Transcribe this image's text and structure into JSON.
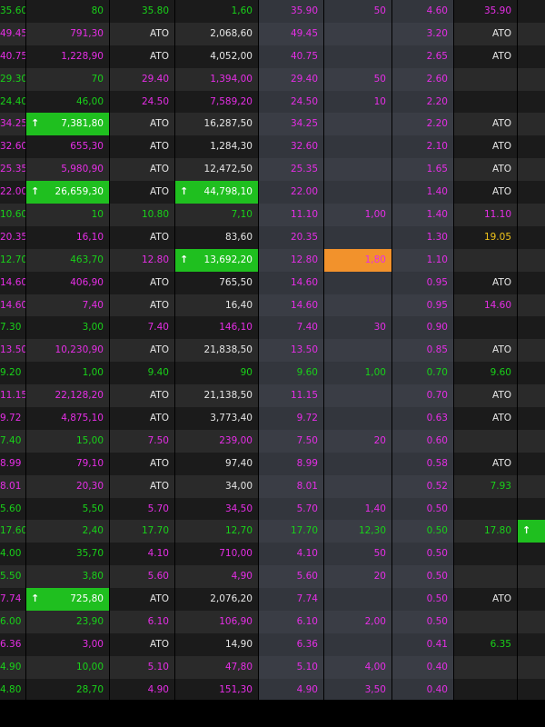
{
  "colors": {
    "green": "#19d219",
    "magenta": "#e62ee6",
    "white": "#e6e6e6",
    "yellow": "#f0c41b",
    "up_bg": "#1fbf1f",
    "highlight_bg": "#f2922c"
  },
  "rows": [
    [
      "35.60",
      "80",
      "35.80",
      "1,60",
      "35.90",
      "50",
      "4.60",
      "35.90"
    ],
    [
      "49.45",
      "791,30",
      "ATO",
      "2,068,60",
      "49.45",
      "",
      "3.20",
      "ATO"
    ],
    [
      "40.75",
      "1,228,90",
      "ATO",
      "4,052,00",
      "40.75",
      "",
      "2.65",
      "ATO"
    ],
    [
      "29.30",
      "70",
      "29.40",
      "1,394,00",
      "29.40",
      "50",
      "2.60",
      ""
    ],
    [
      "24.40",
      "46,00",
      "24.50",
      "7,589,20",
      "24.50",
      "10",
      "2.20",
      ""
    ],
    [
      "34.25",
      "7,381,80",
      "ATO",
      "16,287,50",
      "34.25",
      "",
      "2.20",
      "ATO"
    ],
    [
      "32.60",
      "655,30",
      "ATO",
      "1,284,30",
      "32.60",
      "",
      "2.10",
      "ATO"
    ],
    [
      "25.35",
      "5,980,90",
      "ATO",
      "12,472,50",
      "25.35",
      "",
      "1.65",
      "ATO"
    ],
    [
      "22.00",
      "26,659,30",
      "ATO",
      "44,798,10",
      "22.00",
      "",
      "1.40",
      "ATO"
    ],
    [
      "10.60",
      "10",
      "10.80",
      "7,10",
      "11.10",
      "1,00",
      "1.40",
      "11.10"
    ],
    [
      "20.35",
      "16,10",
      "ATO",
      "83,60",
      "20.35",
      "",
      "1.30",
      "19.05"
    ],
    [
      "12.70",
      "463,70",
      "12.80",
      "13,692,20",
      "12.80",
      "1,80",
      "1.10",
      ""
    ],
    [
      "14.60",
      "406,90",
      "ATO",
      "765,50",
      "14.60",
      "",
      "0.95",
      "ATO"
    ],
    [
      "14.60",
      "7,40",
      "ATO",
      "16,40",
      "14.60",
      "",
      "0.95",
      "14.60"
    ],
    [
      "7.30",
      "3,00",
      "7.40",
      "146,10",
      "7.40",
      "30",
      "0.90",
      ""
    ],
    [
      "13.50",
      "10,230,90",
      "ATO",
      "21,838,50",
      "13.50",
      "",
      "0.85",
      "ATO"
    ],
    [
      "9.20",
      "1,00",
      "9.40",
      "90",
      "9.60",
      "1,00",
      "0.70",
      "9.60"
    ],
    [
      "11.15",
      "22,128,20",
      "ATO",
      "21,138,50",
      "11.15",
      "",
      "0.70",
      "ATO"
    ],
    [
      "9.72",
      "4,875,10",
      "ATO",
      "3,773,40",
      "9.72",
      "",
      "0.63",
      "ATO"
    ],
    [
      "7.40",
      "15,00",
      "7.50",
      "239,00",
      "7.50",
      "20",
      "0.60",
      ""
    ],
    [
      "8.99",
      "79,10",
      "ATO",
      "97,40",
      "8.99",
      "",
      "0.58",
      "ATO"
    ],
    [
      "8.01",
      "20,30",
      "ATO",
      "34,00",
      "8.01",
      "",
      "0.52",
      "7.93"
    ],
    [
      "5.60",
      "5,50",
      "5.70",
      "34,50",
      "5.70",
      "1,40",
      "0.50",
      ""
    ],
    [
      "17.60",
      "2,40",
      "17.70",
      "12,70",
      "17.70",
      "12,30",
      "0.50",
      "17.80"
    ],
    [
      "4.00",
      "35,70",
      "4.10",
      "710,00",
      "4.10",
      "50",
      "0.50",
      ""
    ],
    [
      "5.50",
      "3,80",
      "5.60",
      "4,90",
      "5.60",
      "20",
      "0.50",
      ""
    ],
    [
      "7.74",
      "725,80",
      "ATO",
      "2,076,20",
      "7.74",
      "",
      "0.50",
      "ATO"
    ],
    [
      "6.00",
      "23,90",
      "6.10",
      "106,90",
      "6.10",
      "2,00",
      "0.50",
      ""
    ],
    [
      "6.36",
      "3,00",
      "ATO",
      "14,90",
      "6.36",
      "",
      "0.41",
      "6.35"
    ],
    [
      "4.90",
      "10,00",
      "5.10",
      "47,80",
      "5.10",
      "4,00",
      "0.40",
      ""
    ],
    [
      "4.80",
      "28,70",
      "4.90",
      "151,30",
      "4.90",
      "3,50",
      "0.40",
      ""
    ]
  ],
  "styles": [
    [
      "g",
      "g",
      "g",
      "g",
      "m",
      "m",
      "m",
      "m"
    ],
    [
      "m",
      "m",
      "w",
      "w",
      "m",
      "m",
      "m",
      "w"
    ],
    [
      "m",
      "m",
      "w",
      "w",
      "m",
      "m",
      "m",
      "w"
    ],
    [
      "g",
      "g",
      "m",
      "m",
      "m",
      "m",
      "m",
      "w"
    ],
    [
      "g",
      "g",
      "m",
      "m",
      "m",
      "m",
      "m",
      "w"
    ],
    [
      "m",
      "up",
      "w",
      "w",
      "m",
      "m",
      "m",
      "w"
    ],
    [
      "m",
      "m",
      "w",
      "w",
      "m",
      "m",
      "m",
      "w"
    ],
    [
      "m",
      "m",
      "w",
      "w",
      "m",
      "m",
      "m",
      "w"
    ],
    [
      "m",
      "up",
      "w",
      "up",
      "m",
      "m",
      "m",
      "w"
    ],
    [
      "g",
      "g",
      "g",
      "g",
      "m",
      "m",
      "m",
      "m"
    ],
    [
      "m",
      "m",
      "w",
      "w",
      "m",
      "m",
      "m",
      "y"
    ],
    [
      "g",
      "g",
      "m",
      "up",
      "m",
      "or",
      "m",
      "w"
    ],
    [
      "m",
      "m",
      "w",
      "w",
      "m",
      "m",
      "m",
      "w"
    ],
    [
      "m",
      "m",
      "w",
      "w",
      "m",
      "m",
      "m",
      "m"
    ],
    [
      "g",
      "g",
      "m",
      "m",
      "m",
      "m",
      "m",
      "w"
    ],
    [
      "m",
      "m",
      "w",
      "w",
      "m",
      "m",
      "m",
      "w"
    ],
    [
      "g",
      "g",
      "g",
      "g",
      "g",
      "g",
      "g",
      "g"
    ],
    [
      "m",
      "m",
      "w",
      "w",
      "m",
      "m",
      "m",
      "w"
    ],
    [
      "m",
      "m",
      "w",
      "w",
      "m",
      "m",
      "m",
      "w"
    ],
    [
      "g",
      "g",
      "m",
      "m",
      "m",
      "m",
      "m",
      "w"
    ],
    [
      "m",
      "m",
      "w",
      "w",
      "m",
      "m",
      "m",
      "w"
    ],
    [
      "m",
      "m",
      "w",
      "w",
      "m",
      "m",
      "m",
      "g"
    ],
    [
      "g",
      "g",
      "m",
      "m",
      "m",
      "m",
      "m",
      "w"
    ],
    [
      "g",
      "g",
      "g",
      "g",
      "g",
      "g",
      "g",
      "g"
    ],
    [
      "g",
      "g",
      "m",
      "m",
      "m",
      "m",
      "m",
      "w"
    ],
    [
      "g",
      "g",
      "m",
      "m",
      "m",
      "m",
      "m",
      "w"
    ],
    [
      "m",
      "up",
      "w",
      "w",
      "m",
      "m",
      "m",
      "w"
    ],
    [
      "g",
      "g",
      "m",
      "m",
      "m",
      "m",
      "m",
      "w"
    ],
    [
      "m",
      "m",
      "w",
      "w",
      "m",
      "m",
      "m",
      "g"
    ],
    [
      "g",
      "g",
      "m",
      "m",
      "m",
      "m",
      "m",
      "w"
    ],
    [
      "g",
      "g",
      "m",
      "m",
      "m",
      "m",
      "m",
      "w"
    ]
  ],
  "row_flags": {
    "extra_up_marker_row": 23
  },
  "up_icon": "arrow-up-icon"
}
